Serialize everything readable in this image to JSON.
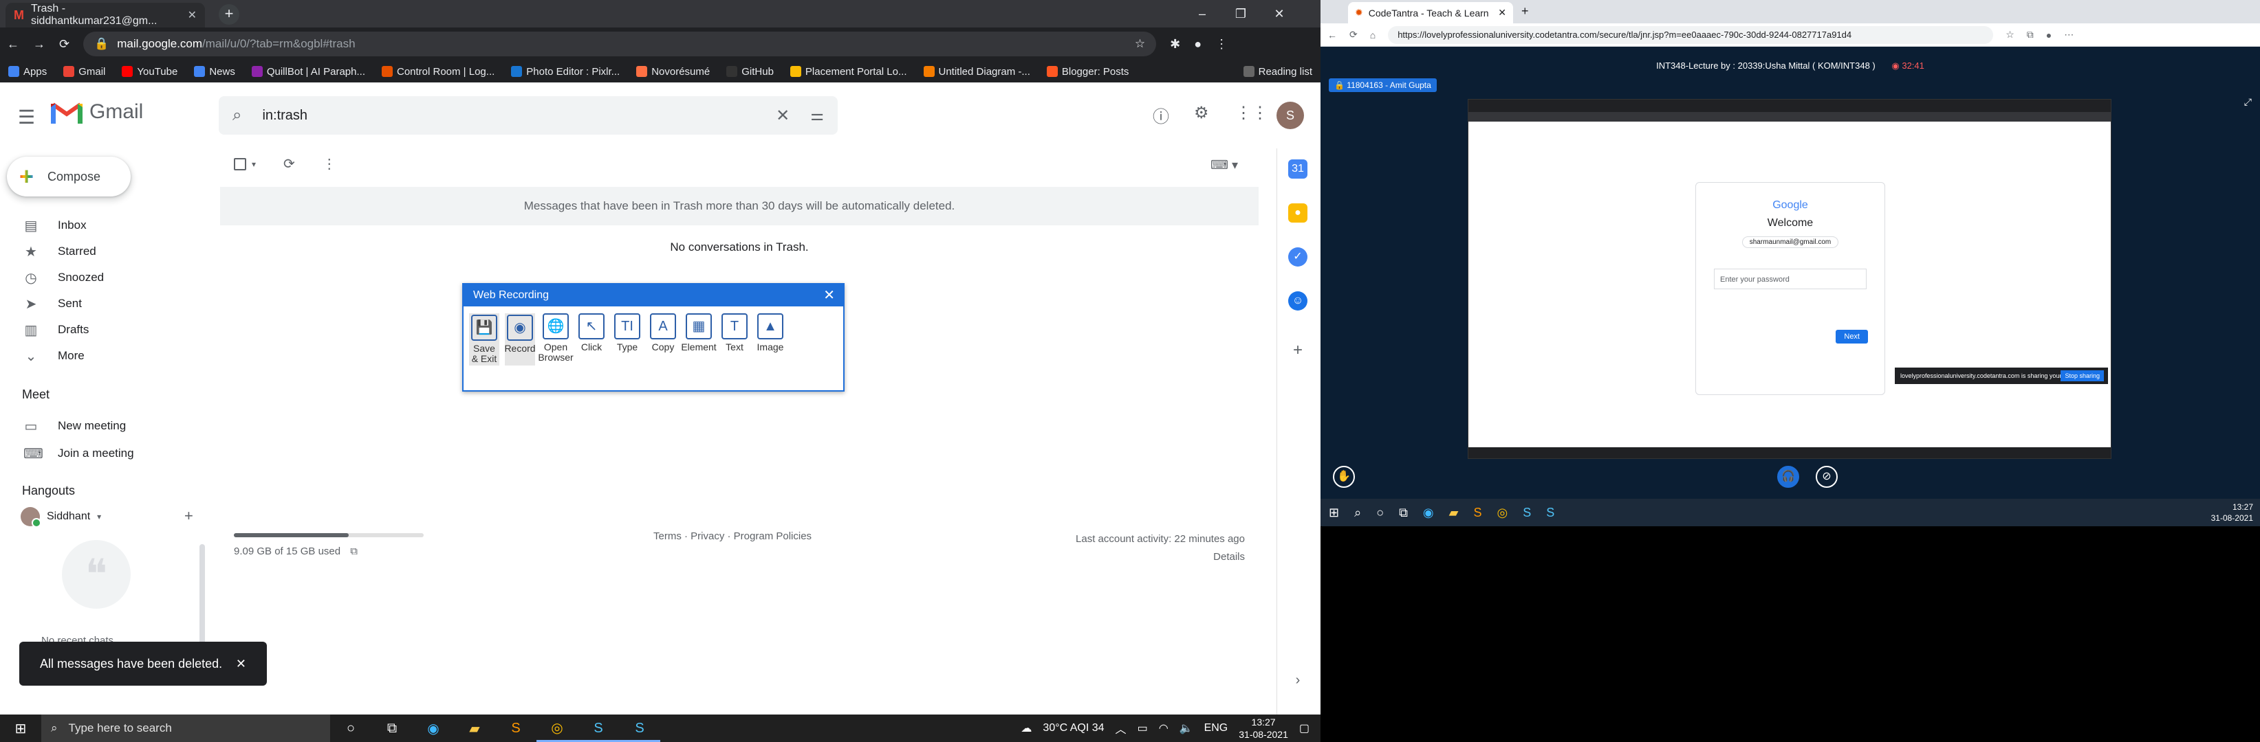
{
  "left": {
    "browser": {
      "tab_title": "Trash - siddhantkumar231@gm...",
      "url_host": "mail.google.com",
      "url_path": "/mail/u/0/?tab=rm&ogbl#trash",
      "bookmarks": [
        "Apps",
        "Gmail",
        "YouTube",
        "News",
        "QuillBot | AI Paraph...",
        "Control Room | Log...",
        "Photo Editor : Pixlr...",
        "Novorésumé",
        "GitHub",
        "Placement Portal Lo...",
        "Untitled Diagram -...",
        "Blogger: Posts",
        "Reading list"
      ]
    },
    "gmail": {
      "product": "Gmail",
      "search_value": "in:trash",
      "compose_label": "Compose",
      "nav": [
        "Inbox",
        "Starred",
        "Snoozed",
        "Sent",
        "Drafts",
        "More"
      ],
      "meet_heading": "Meet",
      "meet": [
        "New meeting",
        "Join a meeting"
      ],
      "hangouts_heading": "Hangouts",
      "hangouts_user": "Siddhant",
      "recent_chats": "No recent chats",
      "trash_banner": "Messages that have been in Trash more than 30 days will be automatically deleted.",
      "empty_text": "No conversations in Trash.",
      "storage_text": "9.09 GB of 15 GB used",
      "storage_fraction": 0.606,
      "footer_links": "Terms · Privacy · Program Policies",
      "last_activity": "Last account activity: 22 minutes ago",
      "details": "Details",
      "toast": "All messages have been deleted."
    },
    "recorder": {
      "title": "Web Recording",
      "tools": [
        "Save & Exit",
        "Record",
        "Open Browser",
        "Click",
        "Type",
        "Copy",
        "Element",
        "Text",
        "Image"
      ]
    },
    "taskbar": {
      "search_placeholder": "Type here to search",
      "weather": "30°C  AQI 34",
      "lang": "ENG",
      "time": "13:27",
      "date": "31-08-2021"
    }
  },
  "right": {
    "tab_title": "CodeTantra - Teach & Learn",
    "url": "https://lovelyprofessionaluniversity.codetantra.com/secure/tla/jnr.jsp?m=ee0aaaec-790c-30dd-9244-0827717a91d4",
    "lecture_title": "INT348-Lecture by : 20339:Usha Mittal ( KOM/INT348 )",
    "timer": "32:41",
    "presenter": "11804163 - Amit Gupta",
    "shared": {
      "google": "Google",
      "welcome": "Welcome",
      "email": "sharmaunmail@gmail.com",
      "password_placeholder": "Enter your password",
      "next": "Next",
      "share_notice": "lovelyprofessionaluniversity.codetantra.com is sharing your screen.",
      "stop_sharing": "Stop sharing"
    },
    "time": "13:27",
    "date": "31-08-2021"
  }
}
